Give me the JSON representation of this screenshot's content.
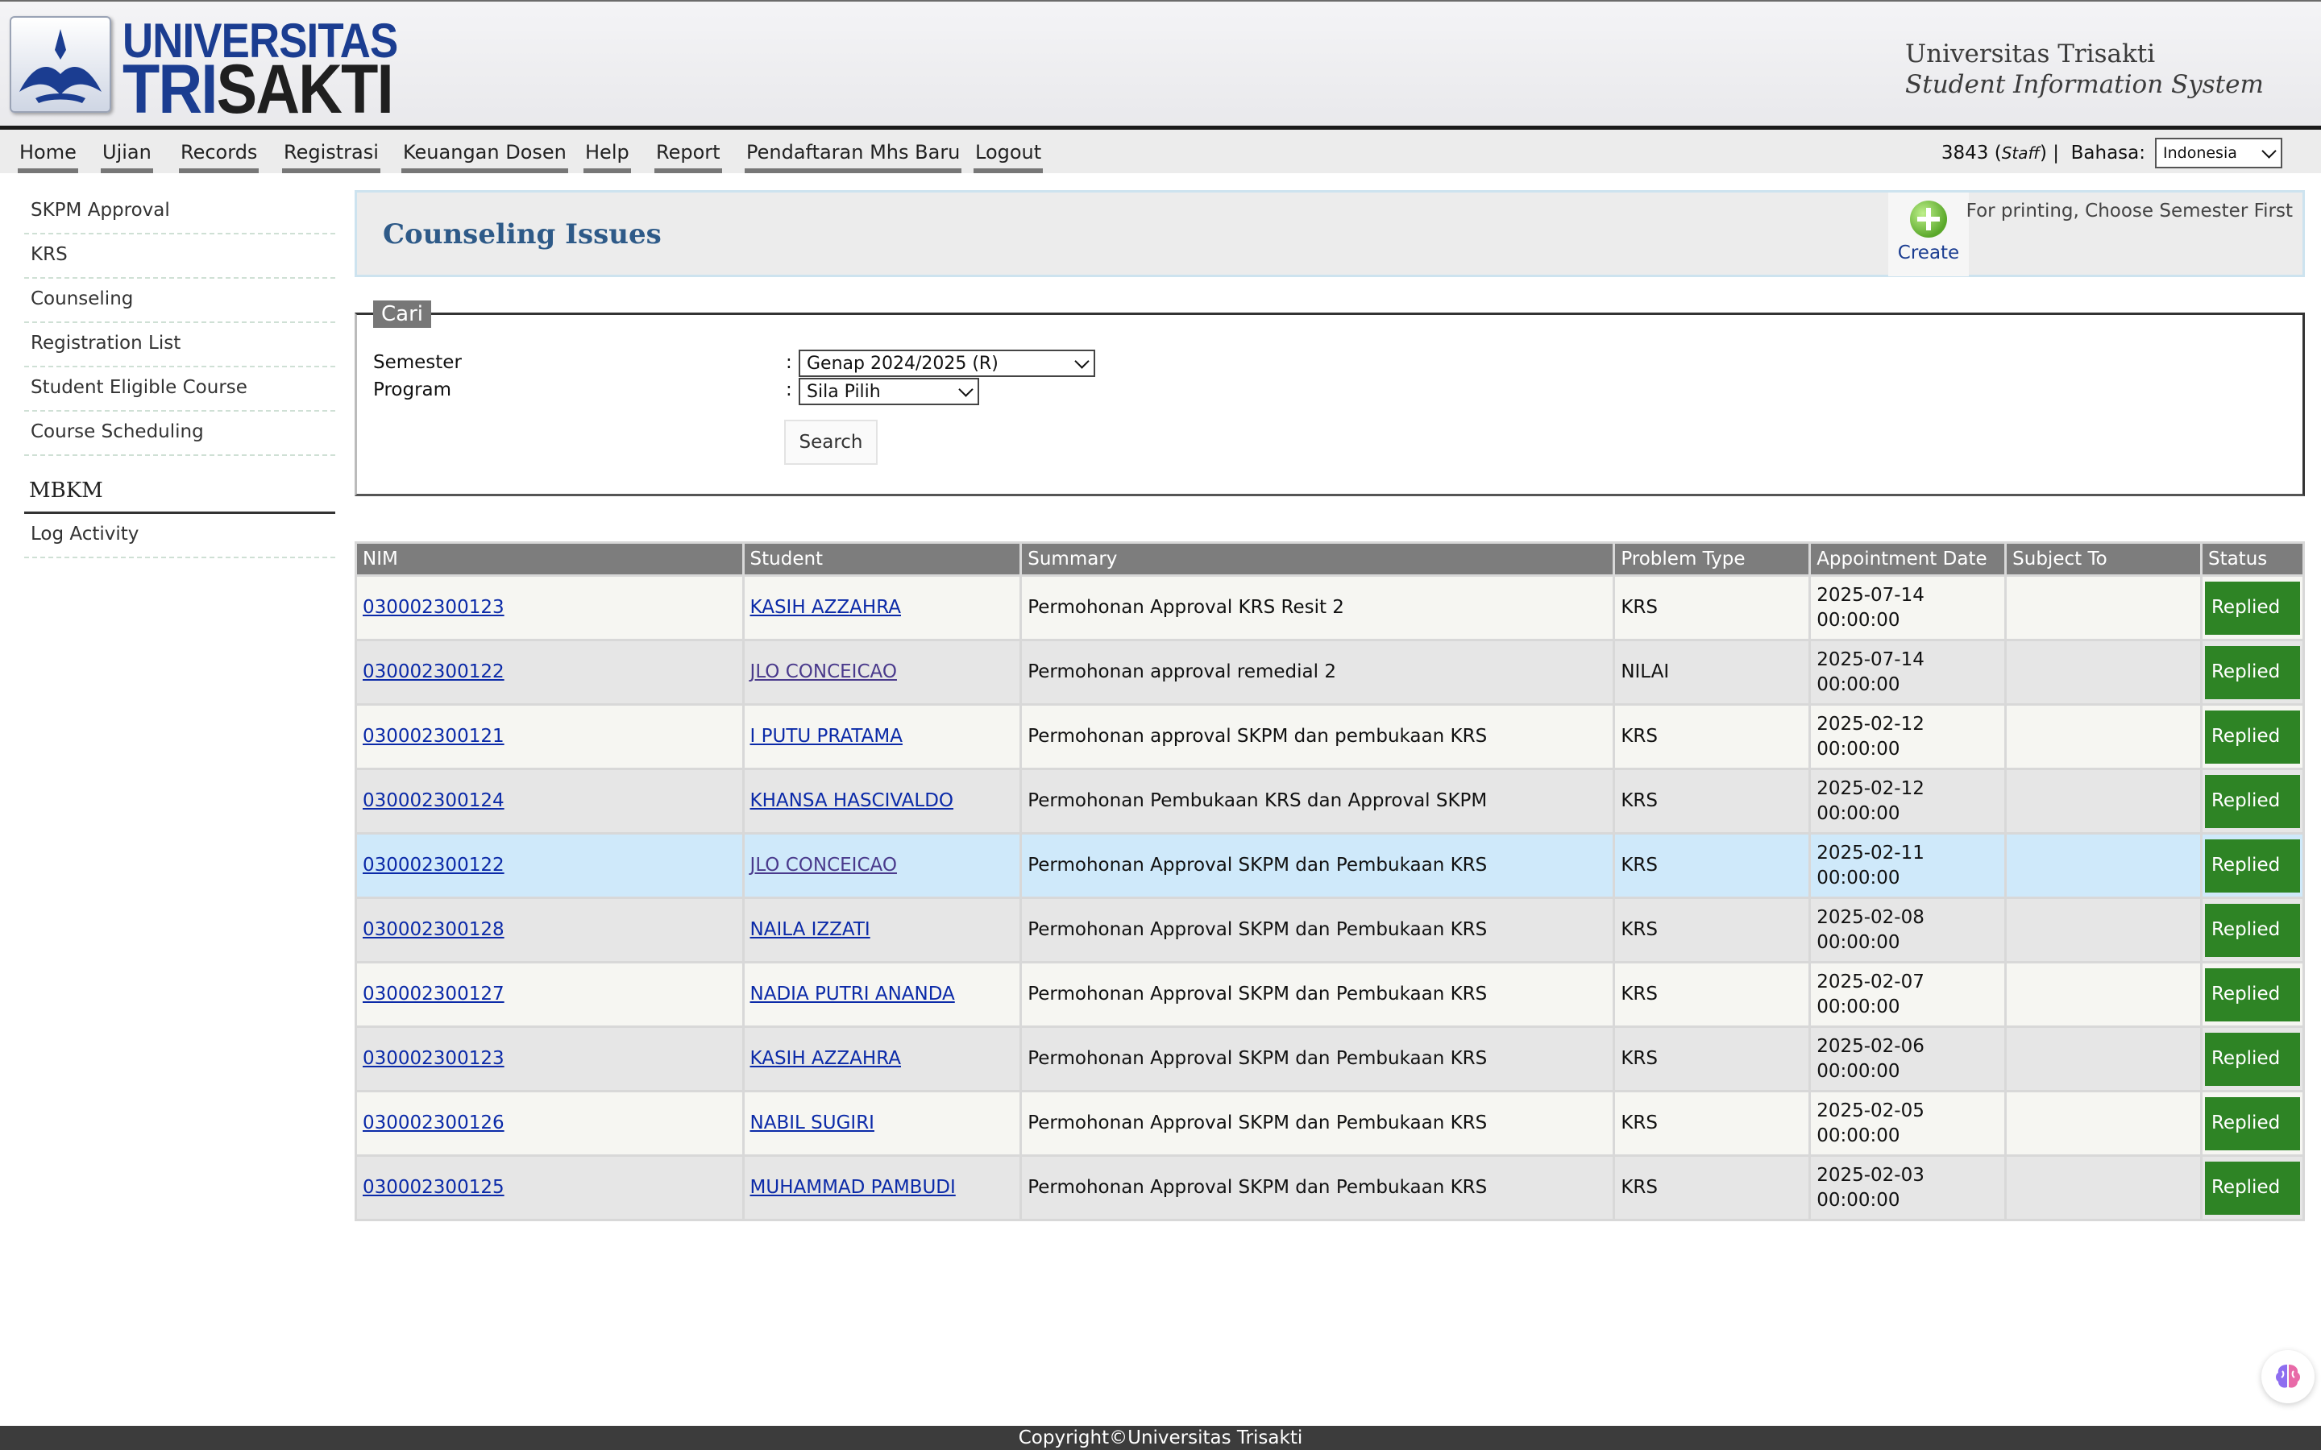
{
  "header": {
    "logo_top": "UNIVERSITAS",
    "logo_bottom_a": "TRI",
    "logo_bottom_b": "SAKTI",
    "institution": "Universitas Trisakti",
    "system_name": "Student Information System"
  },
  "nav": {
    "items": [
      "Home",
      "Ujian",
      "Records",
      "Registrasi",
      "Keuangan Dosen",
      "Help",
      "Report",
      "Pendaftaran Mhs Baru",
      "Logout"
    ],
    "user_id": "3843",
    "role": "Staff",
    "lang_label": "Bahasa:",
    "lang_value": "Indonesia"
  },
  "sidebar": {
    "items": [
      "SKPM Approval",
      "KRS",
      "Counseling",
      "Registration List",
      "Student Eligible Course",
      "Course Scheduling"
    ],
    "section": "MBKM",
    "section_items": [
      "Log Activity"
    ]
  },
  "page": {
    "title": "Counseling Issues",
    "create_label": "Create",
    "print_note": "For printing, Choose Semester First"
  },
  "search": {
    "legend": "Cari",
    "semester_label": "Semester",
    "semester_value": "Genap 2024/2025 (R)",
    "program_label": "Program",
    "program_value": "Sila Pilih",
    "colon": ":",
    "button": "Search"
  },
  "table": {
    "headers": [
      "NIM",
      "Student",
      "Summary",
      "Problem Type",
      "Appointment Date",
      "Subject To",
      "Status"
    ],
    "rows": [
      {
        "nim": "030002300123",
        "student": "KASIH AZZAHRA",
        "summary": "Permohonan Approval KRS Resit 2",
        "type": "KRS",
        "date": "2025-07-14",
        "time": "00:00:00",
        "subject": "",
        "status": "Replied"
      },
      {
        "nim": "030002300122",
        "student": "JLO CONCEICAO",
        "summary": "Permohonan approval remedial 2",
        "type": "NILAI",
        "date": "2025-07-14",
        "time": "00:00:00",
        "subject": "",
        "status": "Replied"
      },
      {
        "nim": "030002300121",
        "student": "I PUTU PRATAMA",
        "summary": "Permohonan approval SKPM dan pembukaan KRS",
        "type": "KRS",
        "date": "2025-02-12",
        "time": "00:00:00",
        "subject": "",
        "status": "Replied"
      },
      {
        "nim": "030002300124",
        "student": "KHANSA HASCIVALDO",
        "summary": "Permohonan Pembukaan KRS dan Approval SKPM",
        "type": "KRS",
        "date": "2025-02-12",
        "time": "00:00:00",
        "subject": "",
        "status": "Replied"
      },
      {
        "nim": "030002300122",
        "student": "JLO CONCEICAO",
        "summary": "Permohonan Approval SKPM dan Pembukaan KRS",
        "type": "KRS",
        "date": "2025-02-11",
        "time": "00:00:00",
        "subject": "",
        "status": "Replied"
      },
      {
        "nim": "030002300128",
        "student": "NAILA IZZATI",
        "summary": "Permohonan Approval SKPM dan Pembukaan KRS",
        "type": "KRS",
        "date": "2025-02-08",
        "time": "00:00:00",
        "subject": "",
        "status": "Replied"
      },
      {
        "nim": "030002300127",
        "student": "NADIA PUTRI ANANDA",
        "summary": "Permohonan Approval SKPM dan Pembukaan KRS",
        "type": "KRS",
        "date": "2025-02-07",
        "time": "00:00:00",
        "subject": "",
        "status": "Replied"
      },
      {
        "nim": "030002300123",
        "student": "KASIH AZZAHRA",
        "summary": "Permohonan Approval SKPM dan Pembukaan KRS",
        "type": "KRS",
        "date": "2025-02-06",
        "time": "00:00:00",
        "subject": "",
        "status": "Replied"
      },
      {
        "nim": "030002300126",
        "student": "NABIL SUGIRI",
        "summary": "Permohonan Approval SKPM dan Pembukaan KRS",
        "type": "KRS",
        "date": "2025-02-05",
        "time": "00:00:00",
        "subject": "",
        "status": "Replied"
      },
      {
        "nim": "030002300125",
        "student": "MUHAMMAD PAMBUDI",
        "summary": "Permohonan Approval SKPM dan Pembukaan KRS",
        "type": "KRS",
        "date": "2025-02-03",
        "time": "00:00:00",
        "subject": "",
        "status": "Replied"
      }
    ]
  },
  "footer": {
    "text": "Copyright©Universitas Trisakti"
  },
  "colors": {
    "brand_blue": "#1b3d91",
    "title_blue": "#2e5a88",
    "status_green": "#2e8425",
    "row_highlight": "#cfe9fa"
  }
}
